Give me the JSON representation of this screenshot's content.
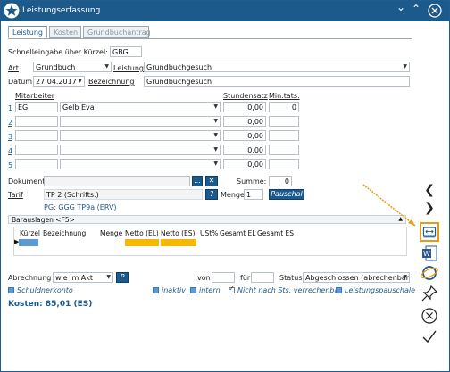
{
  "window": {
    "title": "Leistungserfassung"
  },
  "tabs": [
    {
      "label": "Leistung",
      "active": true
    },
    {
      "label": "Kosten",
      "active": false
    },
    {
      "label": "Grundbuchantrag",
      "active": false
    }
  ],
  "form": {
    "schnelleingabe_label": "Schnelleingabe über Kürzel:",
    "schnelleingabe_value": "GBG",
    "art_label": "Art",
    "art_value": "Grundbuch",
    "leistung_label": "Leistung",
    "leistung_value": "Grundbuchgesuch",
    "datum_label": "Datum",
    "datum_value": "27.04.2017",
    "bezeichnung_label": "Bezeichnung",
    "bezeichnung_value": "Grundbuchgesuch",
    "mitarbeiter_label": "Mitarbeiter",
    "stundensatz_label": "Stundensatz",
    "min_tats_label": "Min.tats.",
    "rows": [
      {
        "num": "1",
        "kuerzel": "EG",
        "name": "Gelb Eva",
        "stundensatz": "0,00",
        "min": "0"
      },
      {
        "num": "2",
        "kuerzel": "",
        "name": "",
        "stundensatz": "0,00",
        "min": ""
      },
      {
        "num": "3",
        "kuerzel": "",
        "name": "",
        "stundensatz": "0,00",
        "min": ""
      },
      {
        "num": "4",
        "kuerzel": "",
        "name": "",
        "stundensatz": "0,00",
        "min": ""
      },
      {
        "num": "5",
        "kuerzel": "",
        "name": "",
        "stundensatz": "0,00",
        "min": ""
      }
    ],
    "dokument_label": "Dokument",
    "dokument_browse": "...",
    "summe_label": "Summe:",
    "summe_value": "0",
    "tarif_label": "Tarif",
    "tarif_value": "TP 2 (Schrifts.)",
    "tarif_info": "?",
    "menge_label": "Menge",
    "menge_value": "1",
    "pauschal_label": "Pauschal",
    "pg_text": "PG: GGG TP9a (ERV)"
  },
  "barauslagen": {
    "title": "Barauslagen <F5>",
    "columns": [
      "Kürzel",
      "Bezeichnung",
      "Menge",
      "Netto (EL)",
      "Netto (ES)",
      "USt%",
      "Gesamt EL",
      "Gesamt ES"
    ]
  },
  "bottom": {
    "abrechnung_label": "Abrechnung",
    "abrechnung_value": "wie im Akt",
    "p_button": "P",
    "von_label": "von",
    "fuer_label": "für",
    "status_label": "Status",
    "status_value": "Abgeschlossen (abrechenbar)",
    "checkboxes": [
      {
        "label": "Schuldnerkonto",
        "checked": true,
        "italic": true
      },
      {
        "label": "inaktiv",
        "checked": true,
        "italic": true
      },
      {
        "label": "intern",
        "checked": true,
        "italic": true
      },
      {
        "label": "Nicht nach Sts. verrechenbar",
        "checked": true,
        "italic": true
      },
      {
        "label": "Leistungspauschale",
        "checked": true,
        "italic": true
      }
    ],
    "kosten": "Kosten: 85,01 (ES)"
  },
  "sidebar": {
    "icons": [
      "prev-icon",
      "next-icon",
      "screen-icon",
      "word-icon",
      "ie-icon",
      "pin-icon",
      "cancel-icon",
      "confirm-icon"
    ]
  },
  "colors": {
    "titlebar": "#1d5a8c",
    "highlight_yellow": "#f5b800",
    "cell_blue": "#5b9bd5",
    "accent_orange": "#e89b12"
  }
}
